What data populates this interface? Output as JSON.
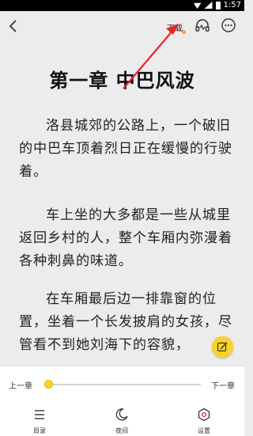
{
  "status_bar": {
    "time": "1:57"
  },
  "toolbar": {
    "download_label": "下载"
  },
  "chapter": {
    "title": "第一章 中巴风波",
    "paragraphs": [
      "洛县城郊的公路上，一个破旧的中巴车顶着烈日正在缓慢的行驶着。",
      "车上坐的大多都是一些从城里返回乡村的人，整个车厢内弥漫着各种刺鼻的味道。",
      "在车厢最后边一排靠窗的位置，坐着一个长发披肩的女孩，尽管看不到她刘海下的容貌，"
    ]
  },
  "bottom": {
    "prev_label": "上一章",
    "next_label": "下一章",
    "progress": 0.0,
    "nav": [
      {
        "label": "目录",
        "icon": "list-icon"
      },
      {
        "label": "夜间",
        "icon": "moon-icon"
      },
      {
        "label": "设置",
        "icon": "settings-icon"
      }
    ]
  },
  "colors": {
    "accent": "#f9d326",
    "arrow": "#e3262f",
    "badge": "#f5a623"
  }
}
